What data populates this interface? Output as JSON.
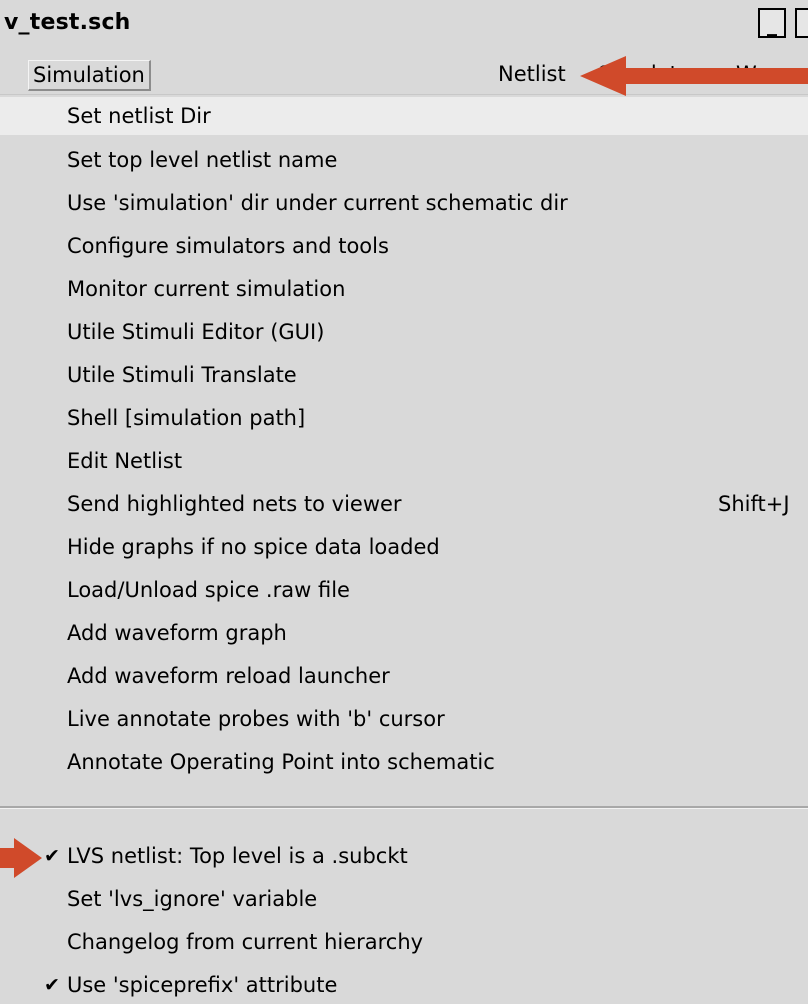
{
  "window": {
    "title": "v_test.sch",
    "minimize_label": "_",
    "maximize_label": "□"
  },
  "menubar": {
    "simulation": "Simulation",
    "netlist": "Netlist",
    "simulate": "Simulate",
    "waves": "Waves"
  },
  "menu": {
    "items": [
      {
        "label": "Set netlist Dir"
      },
      {
        "label": "Set top level netlist name"
      },
      {
        "label": "Use 'simulation' dir under current schematic dir"
      },
      {
        "label": "Configure simulators and tools"
      },
      {
        "label": "Monitor current simulation"
      },
      {
        "label": "Utile Stimuli Editor (GUI)"
      },
      {
        "label": "Utile Stimuli Translate"
      },
      {
        "label": "Shell [simulation path]"
      },
      {
        "label": "Edit Netlist"
      },
      {
        "label": "Send highlighted nets to viewer",
        "shortcut": "Shift+J"
      },
      {
        "label": "Hide graphs if no spice data loaded"
      },
      {
        "label": "Load/Unload spice .raw file"
      },
      {
        "label": "Add waveform graph"
      },
      {
        "label": "Add waveform reload launcher"
      },
      {
        "label": "Live annotate probes with 'b' cursor"
      },
      {
        "label": "Annotate Operating Point into schematic"
      },
      {
        "label": "LVS netlist: Top level is a .subckt",
        "checked": true
      },
      {
        "label": "Set 'lvs_ignore' variable"
      },
      {
        "label": "Changelog from current hierarchy"
      },
      {
        "label": "Use 'spiceprefix' attribute",
        "checked": true
      }
    ],
    "check_glyph": "✔"
  },
  "colors": {
    "background": "#d9d9d9",
    "hover": "#ececec",
    "annotation_arrow": "#d04a2a"
  }
}
